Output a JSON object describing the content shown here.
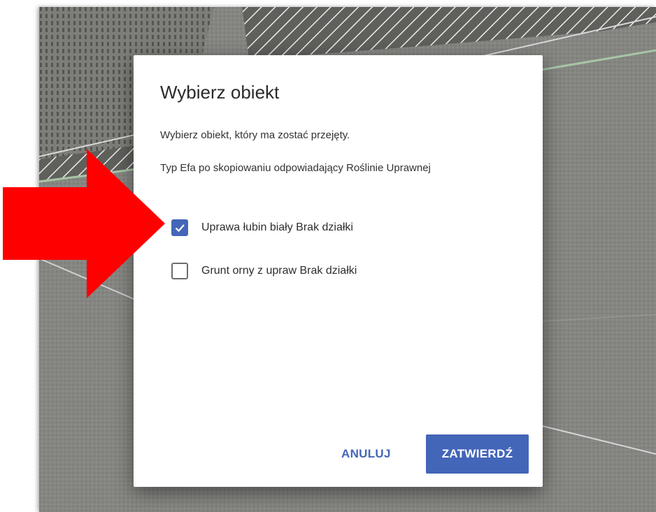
{
  "dialog": {
    "title": "Wybierz obiekt",
    "instruction": "Wybierz obiekt, który ma zostać przejęty.",
    "subtitle": "Typ Efa po skopiowaniu odpowiadający Roślinie Uprawnej",
    "options": [
      {
        "label": "Uprawa łubin biały Brak działki",
        "checked": true
      },
      {
        "label": "Grunt orny z upraw Brak działki",
        "checked": false
      }
    ],
    "cancel_label": "ANULUJ",
    "confirm_label": "ZATWIERDŹ"
  },
  "annotation": {
    "arrow_icon": "red-arrow-icon",
    "color": "#ff0000"
  },
  "colors": {
    "accent": "#4466b8",
    "text": "#2b2b2b",
    "map_stripe": "#e8e8e8",
    "map_dark": "#5c5d59"
  }
}
